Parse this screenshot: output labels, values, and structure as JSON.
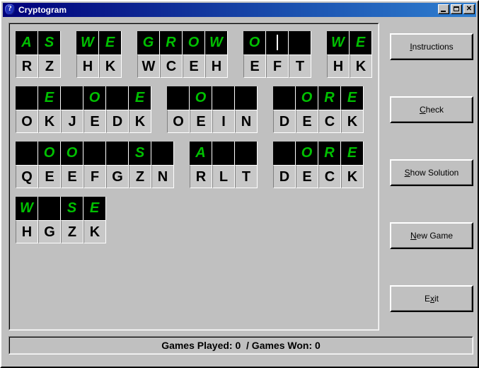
{
  "window": {
    "title": "Cryptogram",
    "icon": "question-badge-icon",
    "minimize_label": "",
    "maximize_label": "",
    "close_label": "✕",
    "titlebar_color_start": "#000080",
    "titlebar_color_end": "#2f7fd0",
    "face_color": "#c0c0c0"
  },
  "puzzle": {
    "cipher_color": "#00c000",
    "cipher_bg": "#000000",
    "letter_color": "#000000",
    "letter_bg": "#c8c8c8",
    "caret_word": 3,
    "caret_cell": 1,
    "rows": [
      {
        "words": [
          {
            "cipher": [
              "A",
              "S"
            ],
            "letters": [
              "R",
              "Z"
            ]
          },
          {
            "cipher": [
              "W",
              "E"
            ],
            "letters": [
              "H",
              "K"
            ]
          },
          {
            "cipher": [
              "G",
              "R",
              "O",
              "W"
            ],
            "letters": [
              "W",
              "C",
              "E",
              "H"
            ]
          },
          {
            "cipher": [
              "O",
              "",
              ""
            ],
            "letters": [
              "E",
              "F",
              "T"
            ]
          },
          {
            "cipher": [
              "W",
              "E"
            ],
            "letters": [
              "H",
              "K"
            ]
          }
        ]
      },
      {
        "words": [
          {
            "cipher": [
              "",
              "E",
              "",
              "O",
              "",
              "E"
            ],
            "letters": [
              "O",
              "K",
              "J",
              "E",
              "D",
              "K"
            ]
          },
          {
            "cipher": [
              "",
              "O",
              "",
              ""
            ],
            "letters": [
              "O",
              "E",
              "I",
              "N"
            ]
          },
          {
            "cipher": [
              "",
              "O",
              "R",
              "E"
            ],
            "letters": [
              "D",
              "E",
              "C",
              "K"
            ]
          }
        ]
      },
      {
        "words": [
          {
            "cipher": [
              "",
              "O",
              "O",
              "",
              "",
              "S",
              ""
            ],
            "letters": [
              "Q",
              "E",
              "E",
              "F",
              "G",
              "Z",
              "N"
            ]
          },
          {
            "cipher": [
              "A",
              "",
              ""
            ],
            "letters": [
              "R",
              "L",
              "T"
            ]
          },
          {
            "cipher": [
              "",
              "O",
              "R",
              "E"
            ],
            "letters": [
              "D",
              "E",
              "C",
              "K"
            ]
          }
        ]
      },
      {
        "words": [
          {
            "cipher": [
              "W",
              "",
              "S",
              "E"
            ],
            "letters": [
              "H",
              "G",
              "Z",
              "K"
            ]
          }
        ]
      }
    ]
  },
  "buttons": {
    "instructions": {
      "pre": "",
      "accel": "I",
      "post": "nstructions"
    },
    "check": {
      "pre": "",
      "accel": "C",
      "post": "heck"
    },
    "solution": {
      "pre": "",
      "accel": "S",
      "post": "how Solution"
    },
    "newgame": {
      "pre": "",
      "accel": "N",
      "post": "ew Game"
    },
    "exit": {
      "pre": "E",
      "accel": "x",
      "post": "it"
    }
  },
  "status": {
    "text": "Games Played: 0  / Games Won: 0",
    "games_played": 0,
    "games_won": 0
  }
}
